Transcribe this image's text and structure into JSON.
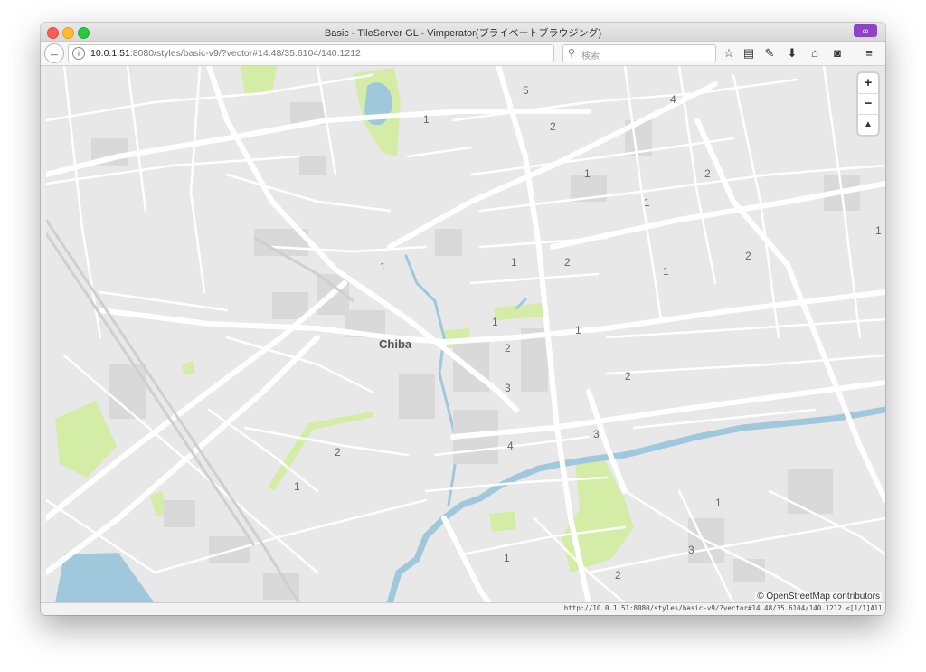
{
  "window": {
    "title": "Basic - TileServer GL - Vimperator(プライベートブラウジング)",
    "private_icon": "mask-icon"
  },
  "toolbar": {
    "back_icon": "←",
    "info_icon": "i",
    "url_host": "10.0.1.51",
    "url_path": ":8080/styles/basic-v9/?vector#14.48/35.6104/140.1212",
    "reload_icon": "C",
    "search_icon": "⚲",
    "search_placeholder": "検索",
    "icons": [
      "bookmark-star-icon",
      "reading-list-icon",
      "wrench-icon",
      "download-icon",
      "home-icon",
      "pocket-icon",
      "menu-icon"
    ]
  },
  "map": {
    "city_label": "Chiba",
    "zoom_in": "+",
    "zoom_out": "−",
    "compass": "▲",
    "attribution": "© OpenStreetMap contributors",
    "street_labels": [
      {
        "text": "5"
      },
      {
        "text": "4"
      },
      {
        "text": "1"
      },
      {
        "text": "2"
      },
      {
        "text": "1"
      },
      {
        "text": "2"
      },
      {
        "text": "1"
      },
      {
        "text": "1"
      },
      {
        "text": "1"
      },
      {
        "text": "1"
      },
      {
        "text": "2"
      },
      {
        "text": "1"
      },
      {
        "text": "2"
      },
      {
        "text": "1"
      },
      {
        "text": "1"
      },
      {
        "text": "2"
      },
      {
        "text": "3"
      },
      {
        "text": "2"
      },
      {
        "text": "3"
      },
      {
        "text": "4"
      },
      {
        "text": "2"
      },
      {
        "text": "1"
      },
      {
        "text": "1"
      },
      {
        "text": "3"
      },
      {
        "text": "1"
      },
      {
        "text": "2"
      }
    ],
    "colors": {
      "land": "#e8e8e8",
      "road": "#ffffff",
      "water": "#a0c8dc",
      "park": "#d3eda6"
    }
  },
  "statusbar": {
    "text": "http://10.0.1.51:8080/styles/basic-v9/?vector#14.48/35.6104/140.1212 <[1/1]All"
  }
}
